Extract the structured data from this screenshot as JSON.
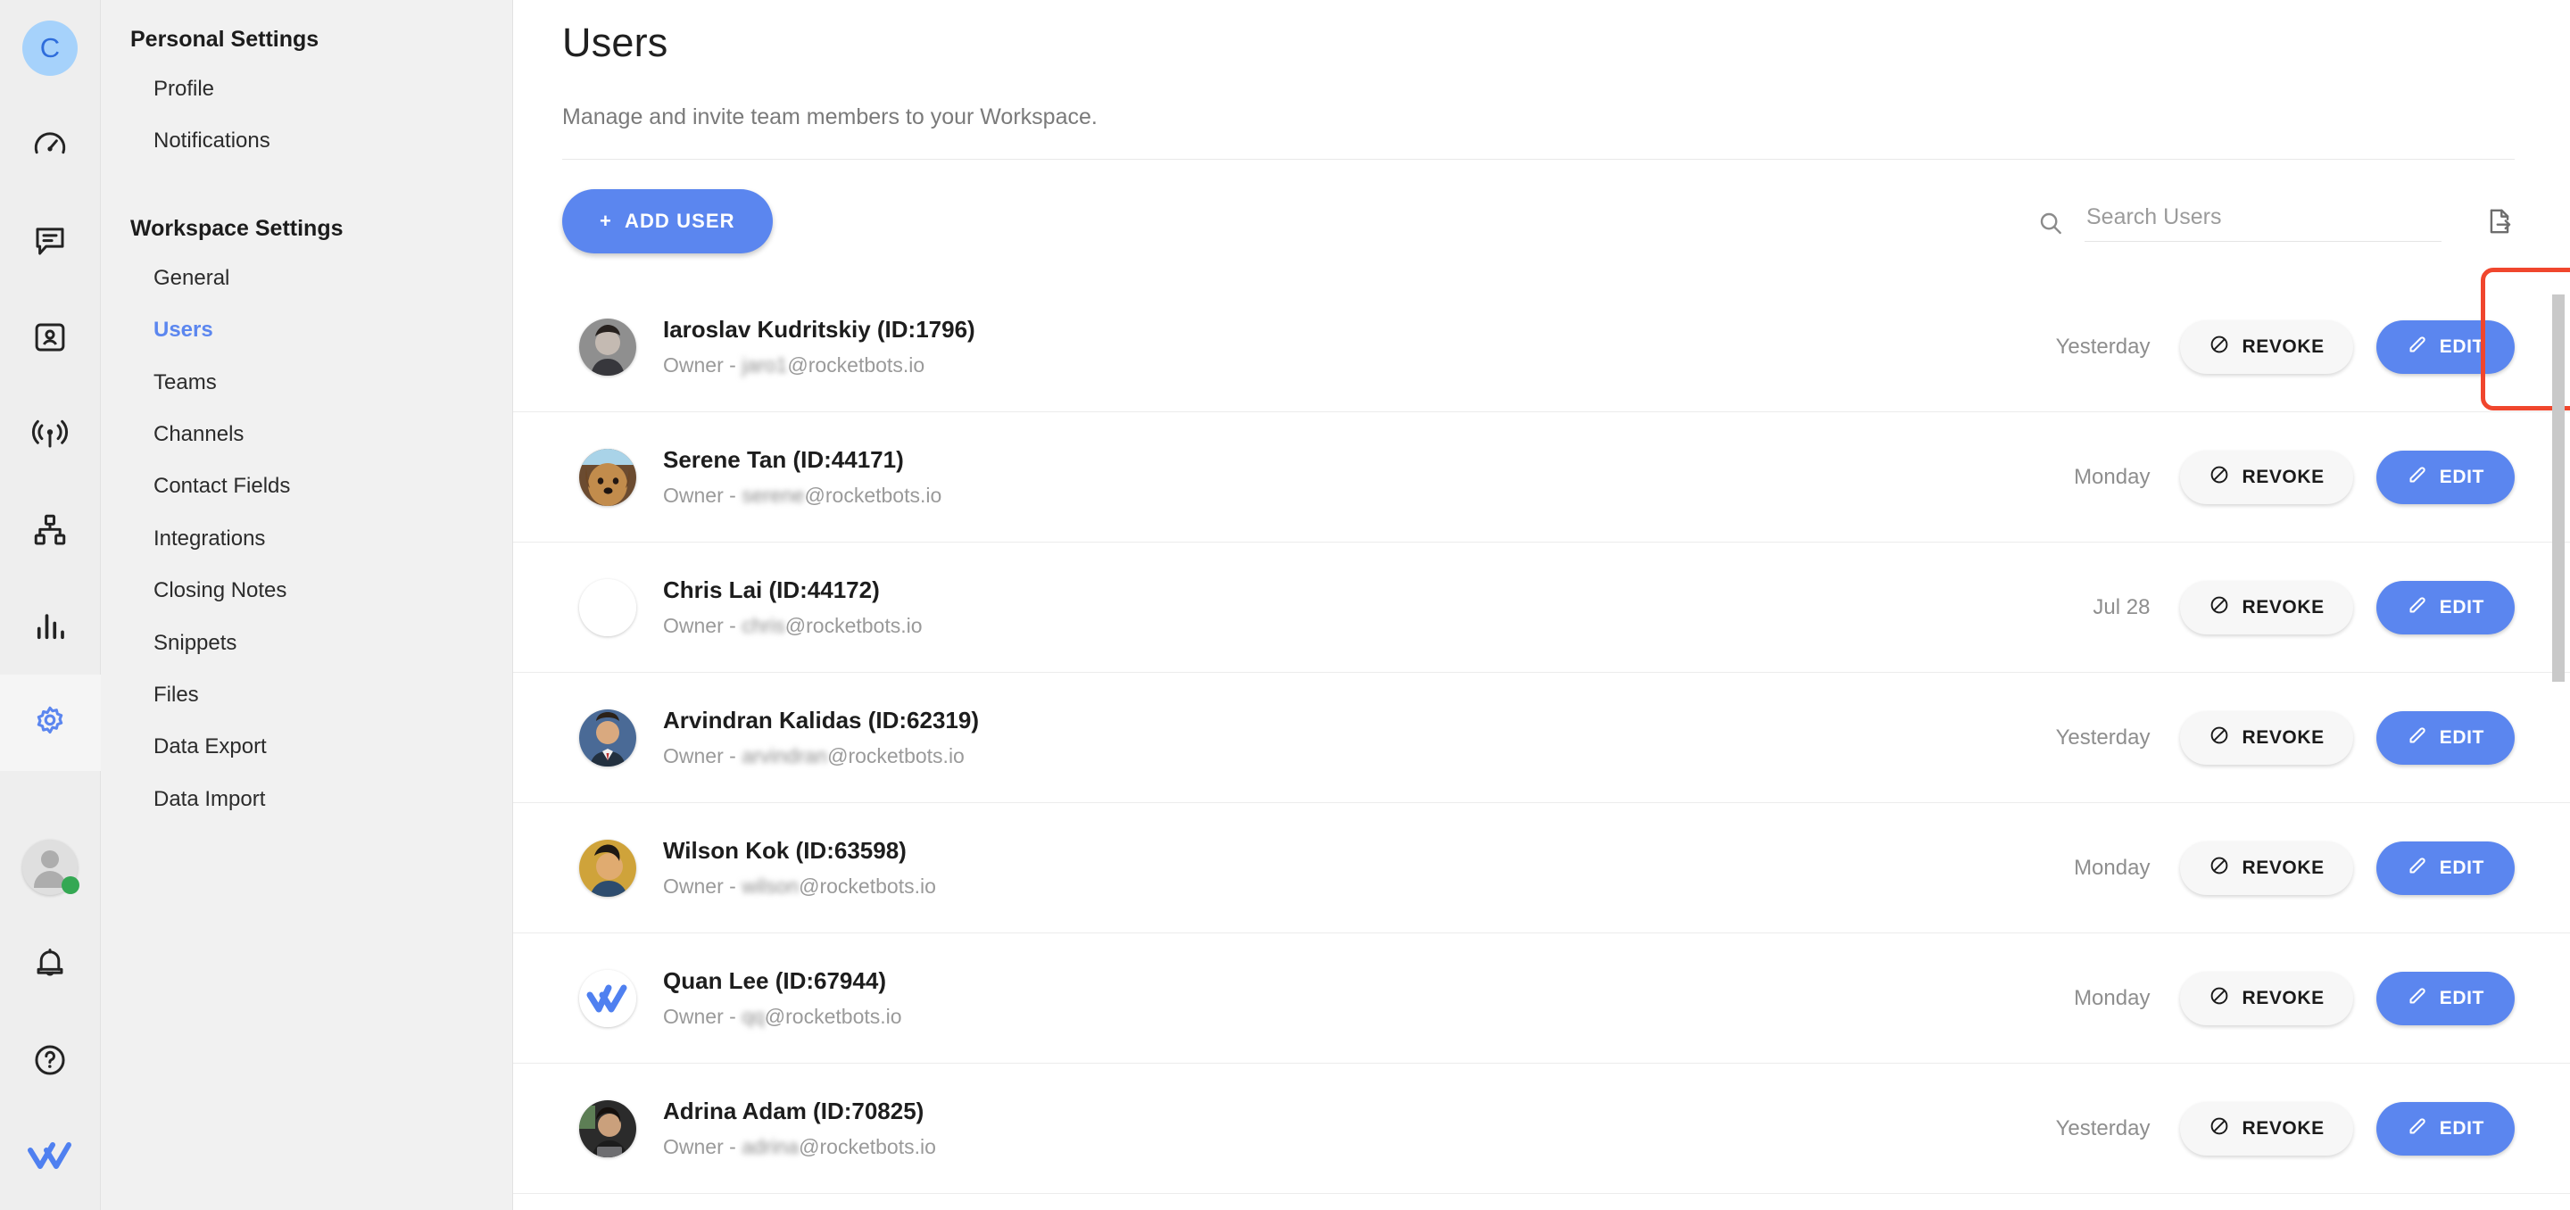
{
  "rail": {
    "workspace_initial": "C",
    "icons": [
      {
        "name": "dashboard-speedometer-icon",
        "label": "Dashboard"
      },
      {
        "name": "messages-chat-icon",
        "label": "Messages"
      },
      {
        "name": "contacts-card-icon",
        "label": "Contacts"
      },
      {
        "name": "broadcast-icon",
        "label": "Broadcasts"
      },
      {
        "name": "workflows-hierarchy-icon",
        "label": "Workflows"
      },
      {
        "name": "reports-bar-chart-icon",
        "label": "Reports"
      },
      {
        "name": "settings-gear-icon",
        "label": "Settings"
      }
    ],
    "bottom": [
      {
        "name": "user-avatar-status-icon",
        "label": "Account",
        "status": "online"
      },
      {
        "name": "notifications-bell-icon",
        "label": "Notifications"
      },
      {
        "name": "help-question-icon",
        "label": "Help"
      },
      {
        "name": "respond-io-logo-icon",
        "label": "respond.io"
      }
    ],
    "accent": "#5b86ef",
    "status_color": "#34a853"
  },
  "nav": {
    "personal": {
      "title": "Personal Settings",
      "items": [
        {
          "label": "Profile",
          "active": false
        },
        {
          "label": "Notifications",
          "active": false
        }
      ]
    },
    "workspace": {
      "title": "Workspace Settings",
      "items": [
        {
          "label": "General",
          "active": false
        },
        {
          "label": "Users",
          "active": true
        },
        {
          "label": "Teams",
          "active": false
        },
        {
          "label": "Channels",
          "active": false
        },
        {
          "label": "Contact Fields",
          "active": false
        },
        {
          "label": "Integrations",
          "active": false
        },
        {
          "label": "Closing Notes",
          "active": false
        },
        {
          "label": "Snippets",
          "active": false
        },
        {
          "label": "Files",
          "active": false
        },
        {
          "label": "Data Export",
          "active": false
        },
        {
          "label": "Data Import",
          "active": false
        }
      ]
    }
  },
  "main": {
    "title": "Users",
    "subtitle": "Manage and invite team members to your Workspace.",
    "add_user_label": "ADD USER",
    "add_user_plus": "+",
    "search_placeholder": "Search Users",
    "search_value": "",
    "export_icon": "export-file-icon",
    "revoke_label": "REVOKE",
    "edit_label": "EDIT"
  },
  "users": [
    {
      "name": "Iaroslav Kudritskiy (ID:1796)",
      "role": "Owner",
      "email_masked": "jaro1",
      "email_domain": "@rocketbots.io",
      "timestamp": "Yesterday",
      "avatar": "photo-man-dark",
      "highlighted": true
    },
    {
      "name": "Serene Tan (ID:44171)",
      "role": "Owner",
      "email_masked": "serene",
      "email_domain": "@rocketbots.io",
      "timestamp": "Monday",
      "avatar": "photo-dog",
      "highlighted": false
    },
    {
      "name": "Chris Lai (ID:44172)",
      "role": "Owner",
      "email_masked": "chris",
      "email_domain": "@rocketbots.io",
      "timestamp": "Jul 28",
      "avatar": "blank",
      "highlighted": false
    },
    {
      "name": "Arvindran Kalidas (ID:62319)",
      "role": "Owner",
      "email_masked": "arvindran",
      "email_domain": "@rocketbots.io",
      "timestamp": "Yesterday",
      "avatar": "photo-man-suit",
      "highlighted": false
    },
    {
      "name": "Wilson Kok (ID:63598)",
      "role": "Owner",
      "email_masked": "wilson",
      "email_domain": "@rocketbots.io",
      "timestamp": "Monday",
      "avatar": "photo-person-yellow",
      "highlighted": false
    },
    {
      "name": "Quan Lee (ID:67944)",
      "role": "Owner",
      "email_masked": "qq",
      "email_domain": "@rocketbots.io",
      "timestamp": "Monday",
      "avatar": "logo-checks",
      "highlighted": false
    },
    {
      "name": "Adrina Adam (ID:70825)",
      "role": "Owner",
      "email_masked": "adrina",
      "email_domain": "@rocketbots.io",
      "timestamp": "Yesterday",
      "avatar": "photo-woman",
      "highlighted": false
    }
  ]
}
